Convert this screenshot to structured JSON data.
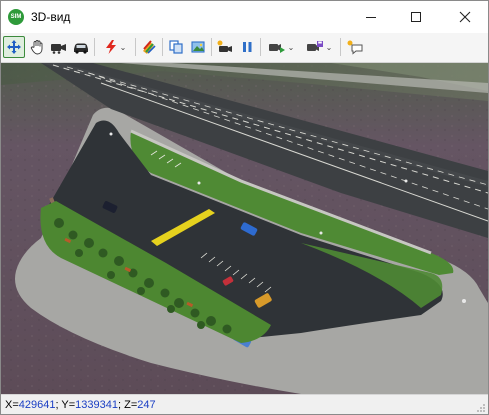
{
  "window": {
    "title": "3D-вид",
    "app_icon_text": "SIM"
  },
  "toolbar": {
    "buttons": [
      {
        "name": "pan-move-tool",
        "icon": "move-arrows-icon",
        "active": true
      },
      {
        "name": "hand-tool",
        "icon": "hand-icon"
      },
      {
        "name": "camera-car-tool",
        "icon": "camera-car-icon"
      },
      {
        "name": "car-view-tool",
        "icon": "car-icon"
      },
      {
        "name": "lightning-tool",
        "icon": "lightning-icon",
        "dropdown": true
      },
      {
        "name": "paint-tool",
        "icon": "paint-icon"
      },
      {
        "name": "copy-tool",
        "icon": "copy-icon"
      },
      {
        "name": "image-tool",
        "icon": "image-icon"
      },
      {
        "name": "record-camera-tool",
        "icon": "record-camera-icon"
      },
      {
        "name": "pause-tool",
        "icon": "pause-icon"
      },
      {
        "name": "play-camera-tool",
        "icon": "play-camera-icon",
        "dropdown": true
      },
      {
        "name": "save-camera-tool",
        "icon": "save-camera-icon",
        "dropdown": true
      },
      {
        "name": "note-tool",
        "icon": "speech-note-icon"
      }
    ]
  },
  "status": {
    "x_label": "X=",
    "x_value": "429641",
    "y_label": "; Y=",
    "y_value": "1339341",
    "z_label": "; Z=",
    "z_value": "247"
  },
  "colors": {
    "accent": "#3c8a3c",
    "coordinate_value": "#1a3ec4",
    "asphalt": "#2f3337",
    "grass": "#4f8a34",
    "field": "#6b5666"
  }
}
